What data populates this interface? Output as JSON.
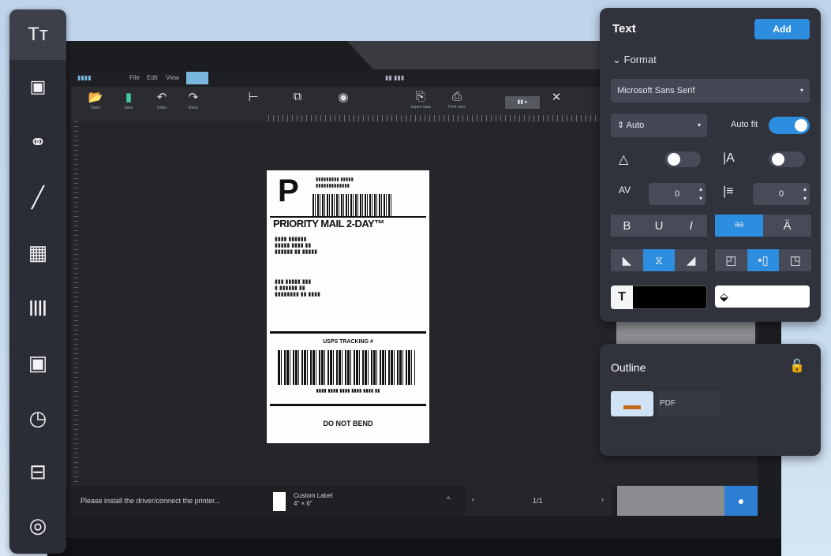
{
  "left_rail": {
    "tools": [
      {
        "name": "text-tool",
        "icon": "text-icon",
        "glyph": "Tт"
      },
      {
        "name": "image-tool",
        "icon": "image-icon",
        "glyph": "🖼"
      },
      {
        "name": "shape-tool",
        "icon": "shapes-icon",
        "glyph": "⚭"
      },
      {
        "name": "line-tool",
        "icon": "line-icon",
        "glyph": "╱"
      },
      {
        "name": "table-tool",
        "icon": "table-icon",
        "glyph": "▦"
      },
      {
        "name": "barcode-tool",
        "icon": "barcode-icon",
        "glyph": "||||"
      },
      {
        "name": "qrcode-tool",
        "icon": "qrcode-icon",
        "glyph": "▣"
      },
      {
        "name": "datetime-tool",
        "icon": "clock-icon",
        "glyph": "◷"
      },
      {
        "name": "serial-tool",
        "icon": "counter-icon",
        "glyph": "⊟"
      },
      {
        "name": "camera-tool",
        "icon": "camera-icon",
        "glyph": "◎"
      }
    ]
  },
  "app": {
    "menu": [
      "▮▮▮▮",
      "File",
      "Edit",
      "View",
      "",
      "▮▮ ▮▮▮"
    ],
    "toolbar": [
      {
        "icon": "open-folder-icon",
        "glyph": "📂",
        "label": "Open"
      },
      {
        "icon": "save-icon",
        "glyph": "▮",
        "label": "Save"
      },
      {
        "icon": "undo-icon",
        "glyph": "↶",
        "label": "Undo"
      },
      {
        "icon": "redo-icon",
        "glyph": "↷",
        "label": "Redo"
      },
      {
        "icon": "align-icon",
        "glyph": "⊢",
        "label": ""
      },
      {
        "icon": "arrange-icon",
        "glyph": "⧉",
        "label": ""
      },
      {
        "icon": "layer-icon",
        "glyph": "◉",
        "label": ""
      },
      {
        "icon": "import-icon",
        "glyph": "⎘",
        "label": "Import data"
      },
      {
        "icon": "print-icon",
        "glyph": "⎙",
        "label": "Print view"
      },
      {
        "icon": "zoom-select-icon",
        "glyph": "▮▮ ▸",
        "label": ""
      },
      {
        "icon": "close-icon",
        "glyph": "✕",
        "label": ""
      }
    ]
  },
  "label": {
    "service_letter": "P",
    "service_name": "PRIORITY MAIL 2-DAY™",
    "from_block": "▮▮▮▮ ▮▮▮▮▮▮\n▮▮▮▮▮ ▮▮▮▮ ▮▮\n▮▮▮▮▮▮ ▮▮ ▮▮▮▮▮",
    "to_block": "▮▮▮ ▮▮▮▮▮ ▮▮▮\n▮ ▮▮▮▮▮▮ ▮▮\n▮▮▮▮▮▮▮▮ ▮▮ ▮▮▮▮",
    "tracking_title": "USPS TRACKING #",
    "tracking_number": "▮▮▮▮ ▮▮▮▮ ▮▮▮▮ ▮▮▮▮ ▮▮▮▮ ▮▮",
    "footer": "DO NOT BEND"
  },
  "status": {
    "message": "Please install the driver/connect the printer...",
    "doc_name": "Custom Label",
    "doc_size": "4\" × 6\"",
    "page": "1/1",
    "prev": "‹",
    "next": "›",
    "up": "^"
  },
  "text_panel": {
    "title": "Text",
    "add_label": "Add",
    "format_label": "Format",
    "font": "Microsoft Sans Serif",
    "font_size": "Auto",
    "autofit_label": "Auto fit",
    "autofit_on": true,
    "letter_spacing": "0",
    "line_spacing": "0",
    "bold": "B",
    "underline": "U",
    "italic": "I",
    "accent_color": "#2d8ee0"
  },
  "outline_panel": {
    "title": "Outline",
    "item_name": "PDF"
  }
}
